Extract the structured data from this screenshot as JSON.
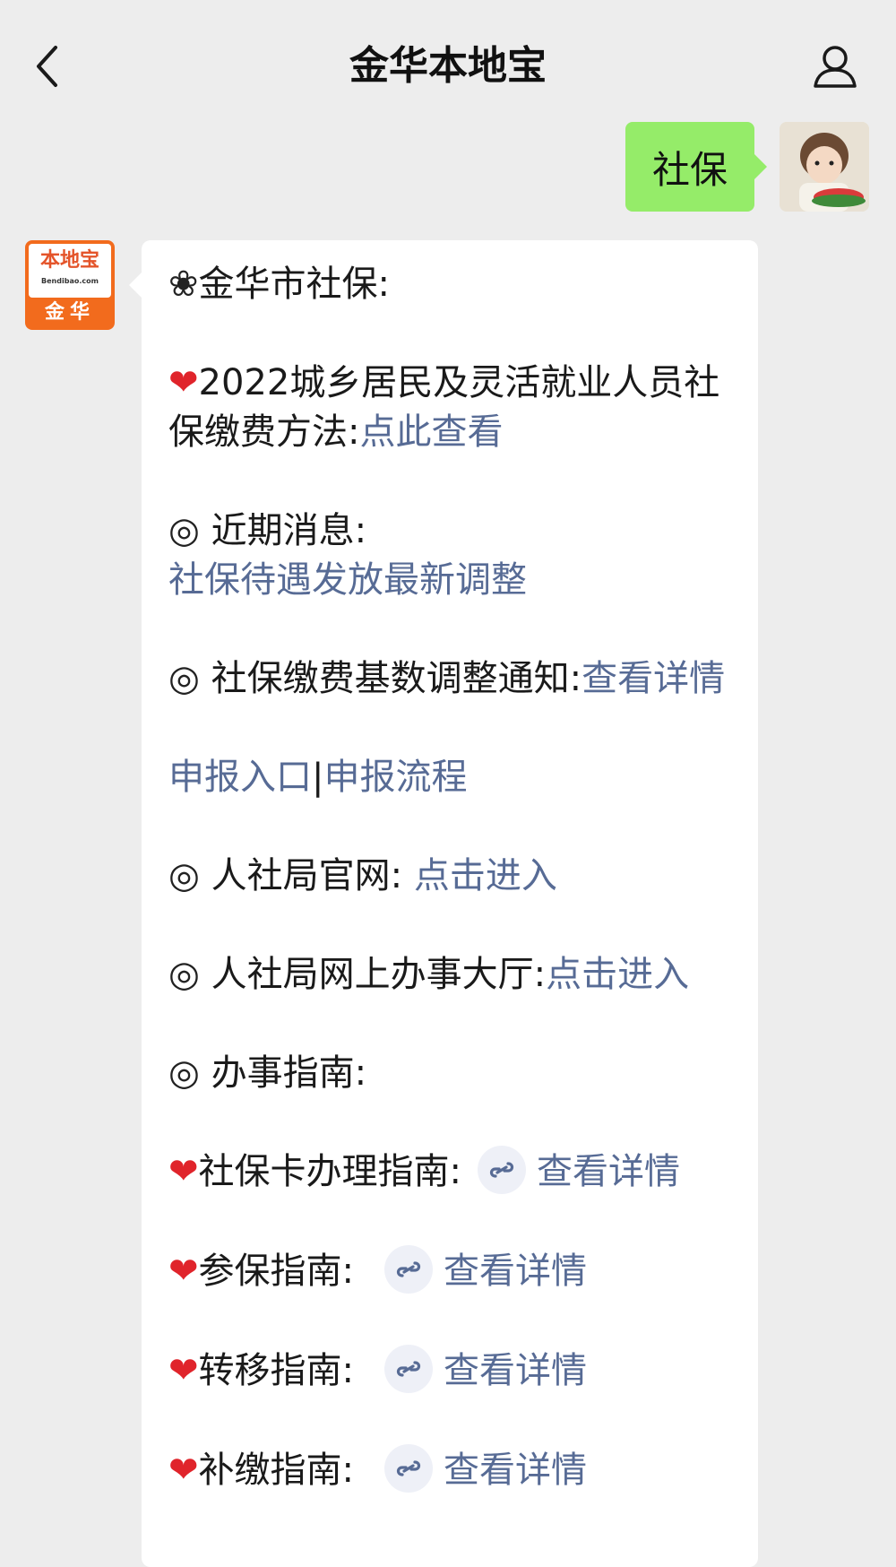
{
  "header": {
    "title": "金华本地宝"
  },
  "chat": {
    "outgoing_text": "社保",
    "bot_logo_top": "本地宝",
    "bot_logo_domain": "Bendibao.com",
    "bot_logo_city": "金华"
  },
  "message": {
    "line1_icon": "❀",
    "line1": "金华市社保:",
    "p2_icon": "❤",
    "p2_text": "2022城乡居民及灵活就业人员社保缴费方法:",
    "p2_link": "点此查看",
    "p3_icon": "◎",
    "p3_text": "近期消息:",
    "p3_link": "社保待遇发放最新调整",
    "p4_icon": "◎",
    "p4_text": "社保缴费基数调整通知:",
    "p4_link": "查看详情",
    "p5_link1": "申报入口",
    "p5_sep": "|",
    "p5_link2": "申报流程",
    "p6_icon": "◎",
    "p6_text": "人社局官网:",
    "p6_link": "点击进入",
    "p7_icon": "◎",
    "p7_text": "人社局网上办事大厅:",
    "p7_link": "点击进入",
    "p8_icon": "◎",
    "p8_text": "办事指南:",
    "guides": [
      {
        "icon": "❤",
        "text": "社保卡办理指南:",
        "link": "查看详情"
      },
      {
        "icon": "❤",
        "text": "参保指南:",
        "link": "查看详情"
      },
      {
        "icon": "❤",
        "text": "转移指南:",
        "link": "查看详情"
      },
      {
        "icon": "❤",
        "text": "补缴指南:",
        "link": "查看详情"
      }
    ]
  },
  "colors": {
    "background": "#ededed",
    "outgoing_bubble": "#95ec69",
    "incoming_bubble": "#ffffff",
    "link": "#576b95",
    "logo_orange": "#f26b1d"
  },
  "icons": [
    "back-icon",
    "profile-icon",
    "mini-program-icon",
    "heart-icon",
    "circle-icon",
    "flower-icon"
  ]
}
